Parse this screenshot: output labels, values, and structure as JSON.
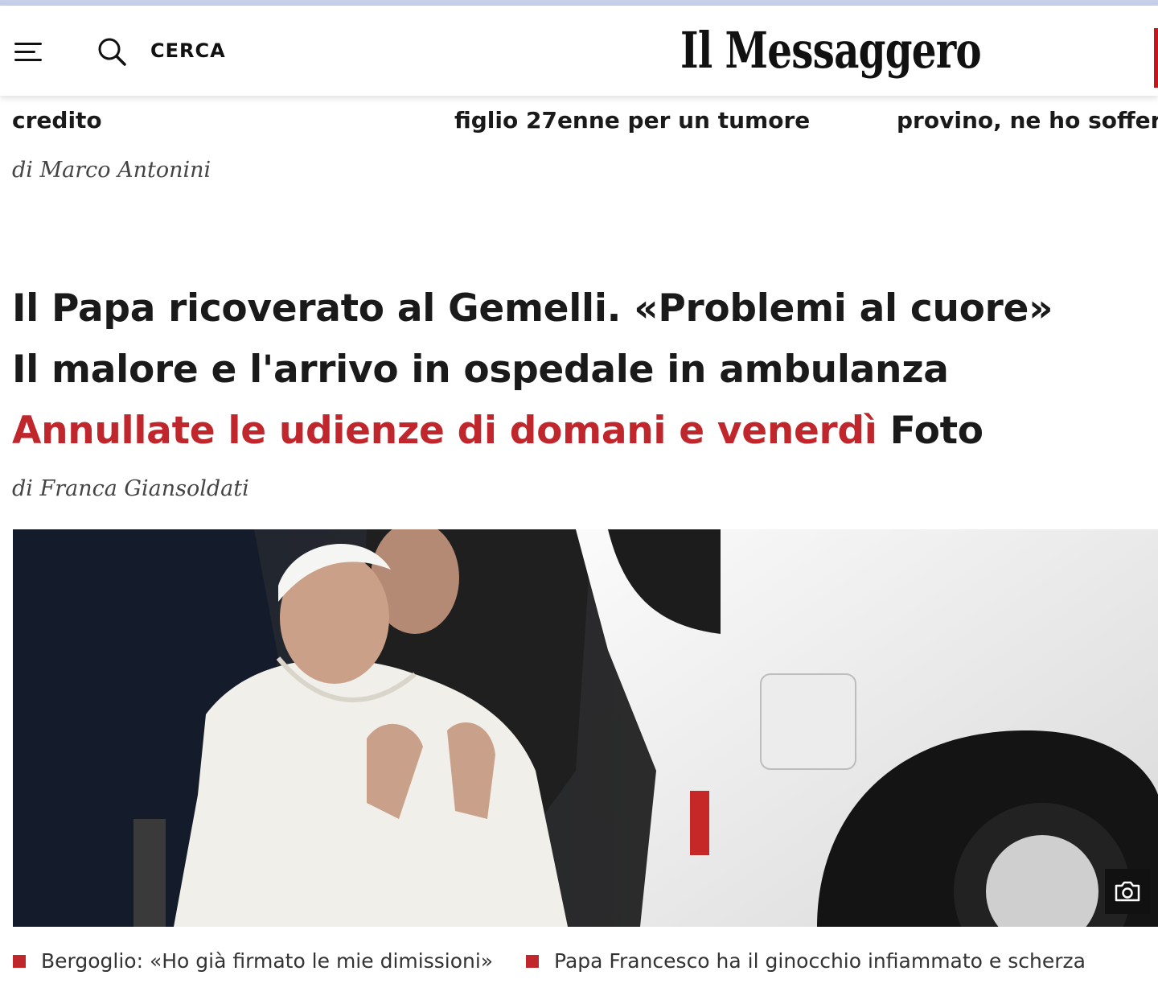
{
  "header": {
    "search_label": "CERCA",
    "logo_text": "Il Messaggero",
    "icons": [
      "hamburger-menu-icon",
      "search-icon"
    ]
  },
  "top_row": {
    "items": [
      {
        "title_fragment": "credito",
        "byline": "di Marco Antonini"
      },
      {
        "title_fragment": "figlio 27enne per un tumore"
      },
      {
        "title_fragment": "provino, ne ho soffert"
      }
    ]
  },
  "lead": {
    "headline_line1": "Il Papa ricoverato al Gemelli. «Problemi al cuore»",
    "headline_line2": "Il malore e l'arrivo in ospedale in ambulanza",
    "headline_red": "Annullate le udienze di domani e venerdì",
    "headline_suffix": "Foto",
    "byline": "di Franca Giansoldati",
    "photo_icon": "camera-icon"
  },
  "related": [
    "Bergoglio: «Ho già firmato le mie dimissioni»",
    "Papa Francesco ha il ginocchio infiammato e scherza"
  ],
  "colors": {
    "accent_red": "#c0272d",
    "text": "#1a1a1a",
    "background": "#ffffff"
  }
}
